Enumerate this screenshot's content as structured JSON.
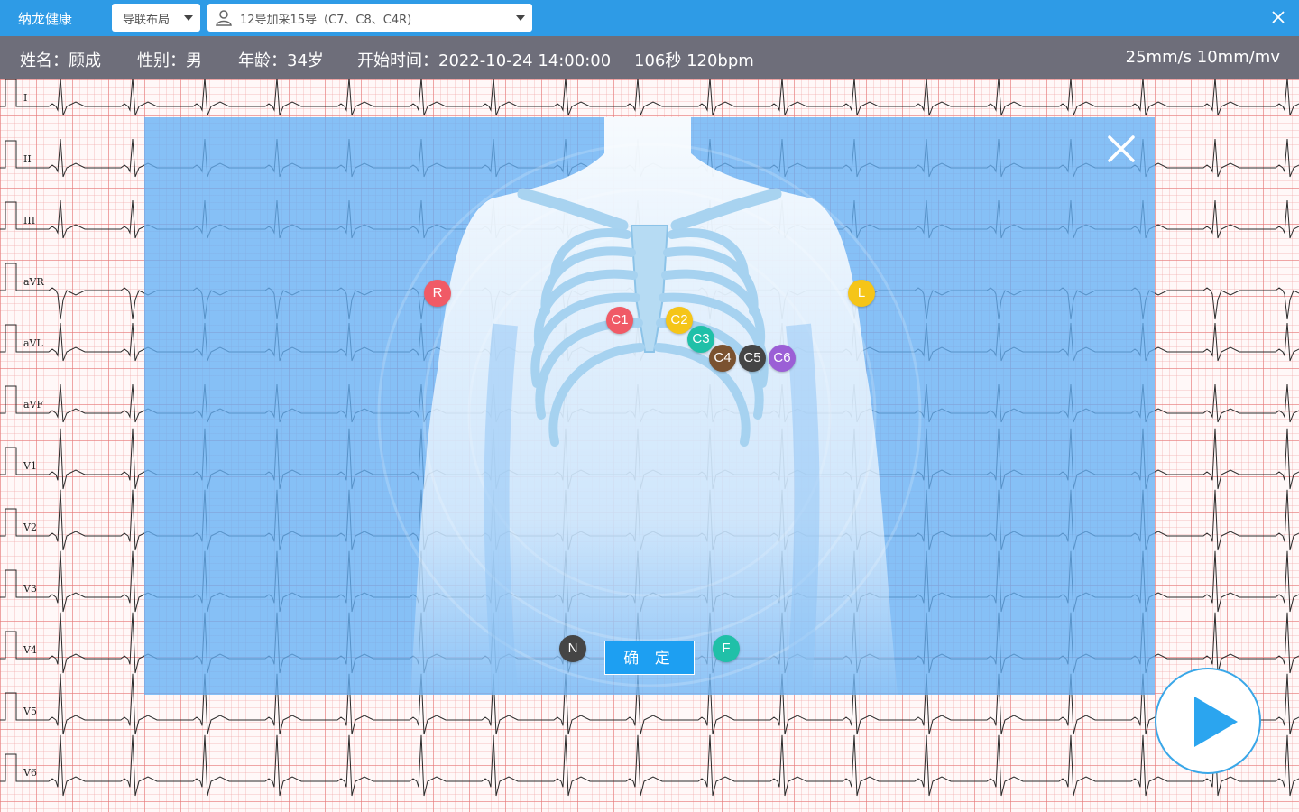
{
  "app": {
    "title": "纳龙健康"
  },
  "toolbar": {
    "layout_select": {
      "value": "导联布局",
      "icon": "caret-down-icon"
    },
    "lead_select": {
      "value": "12导加采15导（C7、C8、C4R)",
      "icon": "person-icon"
    },
    "close_icon": "close-icon"
  },
  "patient": {
    "name": "姓名：顾成",
    "gender": "性别：男",
    "age": "年龄：34岁",
    "start_time": "开始时间：2022-10-24 14:00:00",
    "duration_hr": "106秒  120bpm",
    "speed_gain": "25mm/s  10mm/mv"
  },
  "leads": [
    "I",
    "II",
    "III",
    "aVR",
    "aVL",
    "aVF",
    "V1",
    "V2",
    "V3",
    "V4",
    "V5",
    "V6"
  ],
  "modal": {
    "confirm_label": "确 定",
    "electrodes": [
      {
        "label": "R",
        "color": "#f05a66"
      },
      {
        "label": "L",
        "color": "#f5c518"
      },
      {
        "label": "C1",
        "color": "#f05a66"
      },
      {
        "label": "C2",
        "color": "#f5c518"
      },
      {
        "label": "C3",
        "color": "#20c0a8"
      },
      {
        "label": "C4",
        "color": "#7a5230"
      },
      {
        "label": "C5",
        "color": "#454545"
      },
      {
        "label": "C6",
        "color": "#9b5fd6"
      },
      {
        "label": "N",
        "color": "#454545"
      },
      {
        "label": "F",
        "color": "#20c0a8"
      }
    ]
  },
  "colors": {
    "accent": "#2e9be6",
    "infobar": "#6e6e7a",
    "grid": "#e87878"
  }
}
